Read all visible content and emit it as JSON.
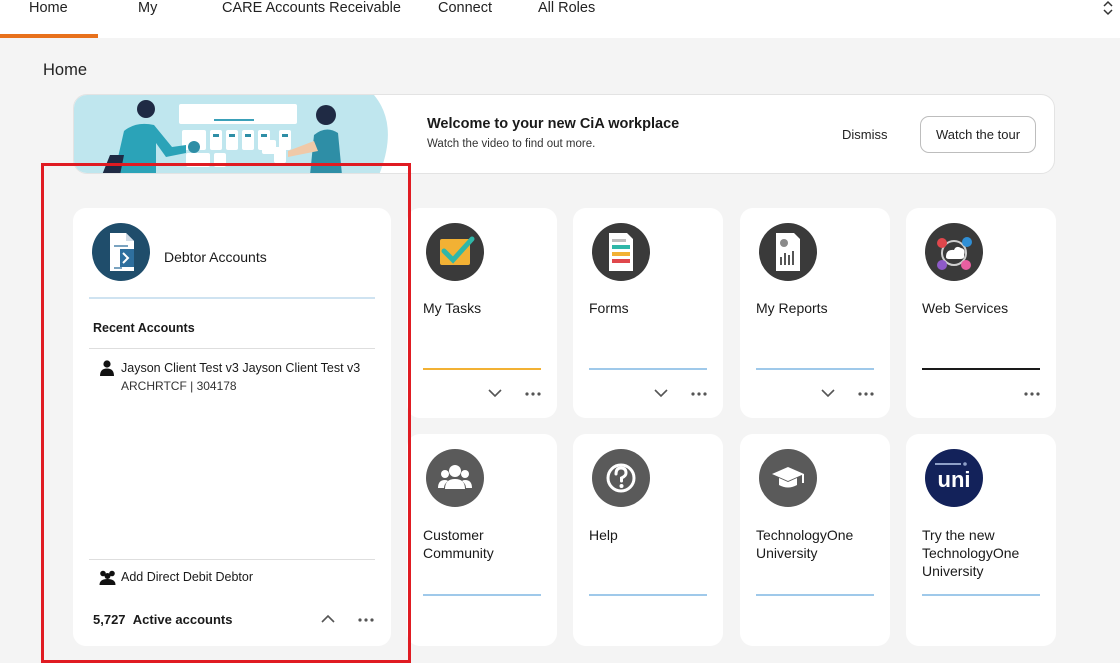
{
  "nav": {
    "items": [
      {
        "label": "Home",
        "active": true
      },
      {
        "label": "My"
      },
      {
        "label": "CARE Accounts Receivable"
      },
      {
        "label": "Connect"
      },
      {
        "label": "All Roles"
      }
    ],
    "accent": "#e8711c"
  },
  "page": {
    "title": "Home"
  },
  "banner": {
    "title": "Welcome to your new CiA workplace",
    "subtitle": "Watch the video to find out more.",
    "dismiss_label": "Dismiss",
    "tour_label": "Watch the tour"
  },
  "debtor_card": {
    "title": "Debtor Accounts",
    "recent_heading": "Recent Accounts",
    "recent_accounts": [
      {
        "name": "Jayson Client Test v3 Jayson Client Test v3",
        "detail": "ARCHRTCF | 304178"
      }
    ],
    "add_label": "Add Direct Debit Debtor",
    "active_count": "5,727",
    "active_label": "Active accounts"
  },
  "tiles": [
    {
      "label": "My Tasks",
      "icon": "tasks-icon",
      "line_color": "#f2b134"
    },
    {
      "label": "Forms",
      "icon": "forms-icon",
      "line_color": "#9fc9ea"
    },
    {
      "label": "My Reports",
      "icon": "reports-icon",
      "line_color": "#9fc9ea"
    },
    {
      "label": "Web Services",
      "icon": "web-services-icon",
      "line_color": "#1a1a1a"
    },
    {
      "label": "Customer Community",
      "icon": "community-icon",
      "line_color": "#9fc9ea"
    },
    {
      "label": "Help",
      "icon": "help-icon",
      "line_color": "#9fc9ea"
    },
    {
      "label": "TechnologyOne University",
      "icon": "graduation-cap-icon",
      "line_color": "#9fc9ea"
    },
    {
      "label": "Try the new TechnologyOne University",
      "icon": "uni-logo-icon",
      "icon_text": "uni",
      "line_color": "#9fc9ea"
    }
  ]
}
